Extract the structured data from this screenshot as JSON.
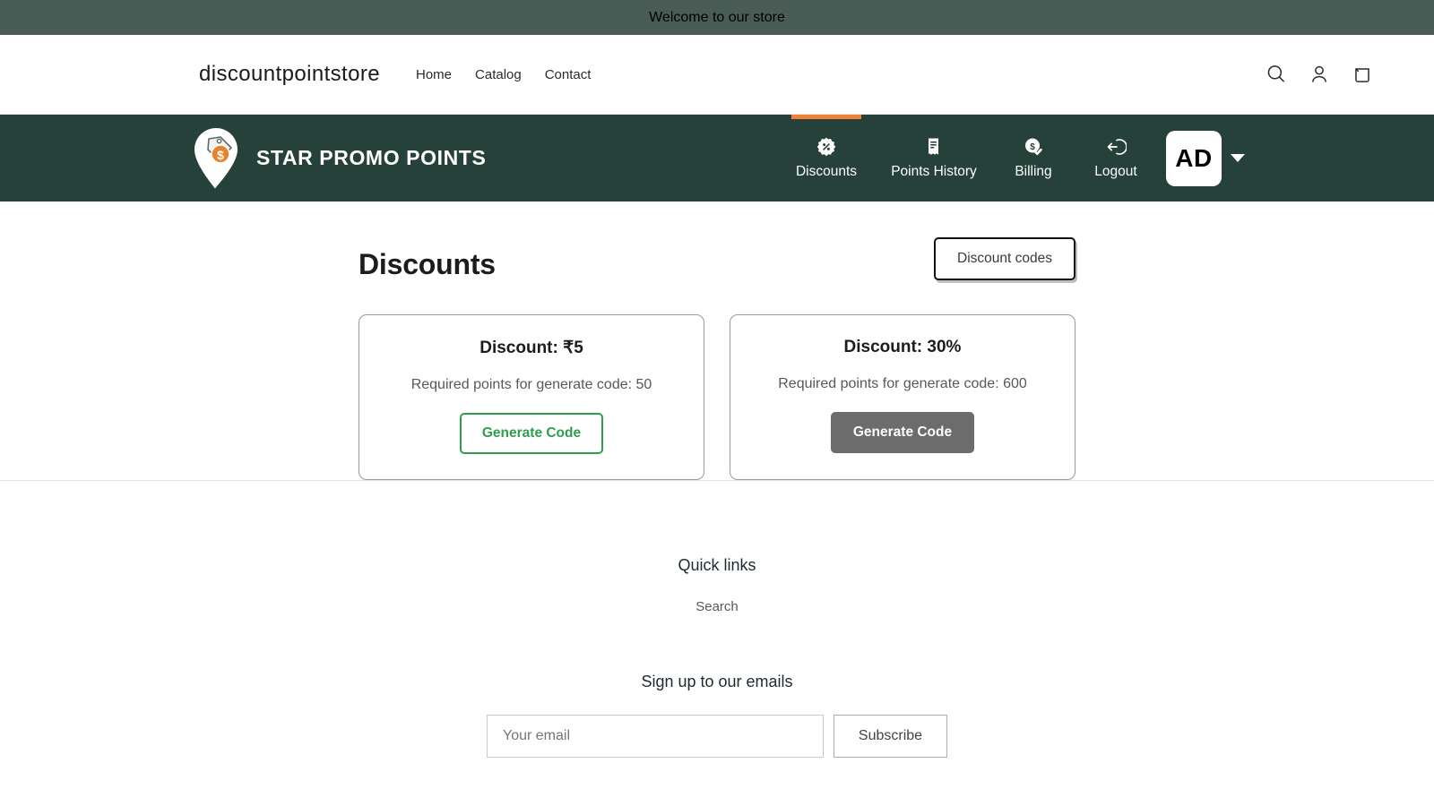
{
  "announcement": {
    "text": "Welcome to our store"
  },
  "store_header": {
    "store_name": "discountpointstore",
    "nav": [
      {
        "label": "Home"
      },
      {
        "label": "Catalog"
      },
      {
        "label": "Contact"
      }
    ],
    "icons": [
      {
        "name": "search-icon"
      },
      {
        "name": "account-icon"
      },
      {
        "name": "cart-icon"
      }
    ]
  },
  "app_nav": {
    "brand_title": "STAR PROMO POINTS",
    "brand_logo_icon": "map-pin-price-tag-icon",
    "accent_color": "#f08237",
    "background_color": "#254139",
    "items": [
      {
        "label": "Discounts",
        "icon": "percent-badge-icon",
        "active": true
      },
      {
        "label": "Points History",
        "icon": "receipt-icon",
        "active": false
      },
      {
        "label": "Billing",
        "icon": "dollar-coin-check-icon",
        "active": false
      },
      {
        "label": "Logout",
        "icon": "logout-arrow-icon",
        "active": false
      }
    ],
    "avatar": {
      "initials": "AD"
    },
    "caret_icon": "chevron-down-icon"
  },
  "main": {
    "title": "Discounts",
    "discount_codes_button": "Discount codes",
    "cards": [
      {
        "title": "Discount: ₹5",
        "subtitle": "Required points for generate code: 50",
        "button_label": "Generate Code",
        "button_state": "enabled",
        "button_color": "#2e9e4d"
      },
      {
        "title": "Discount: 30%",
        "subtitle": "Required points for generate code: 600",
        "button_label": "Generate Code",
        "button_state": "disabled",
        "button_color": "#6c6c6c"
      }
    ]
  },
  "footer": {
    "quick_links_heading": "Quick links",
    "quick_links": [
      {
        "label": "Search"
      }
    ],
    "newsletter_heading": "Sign up to our emails",
    "email_placeholder": "Your email",
    "email_value": "",
    "subscribe_label": "Subscribe"
  }
}
